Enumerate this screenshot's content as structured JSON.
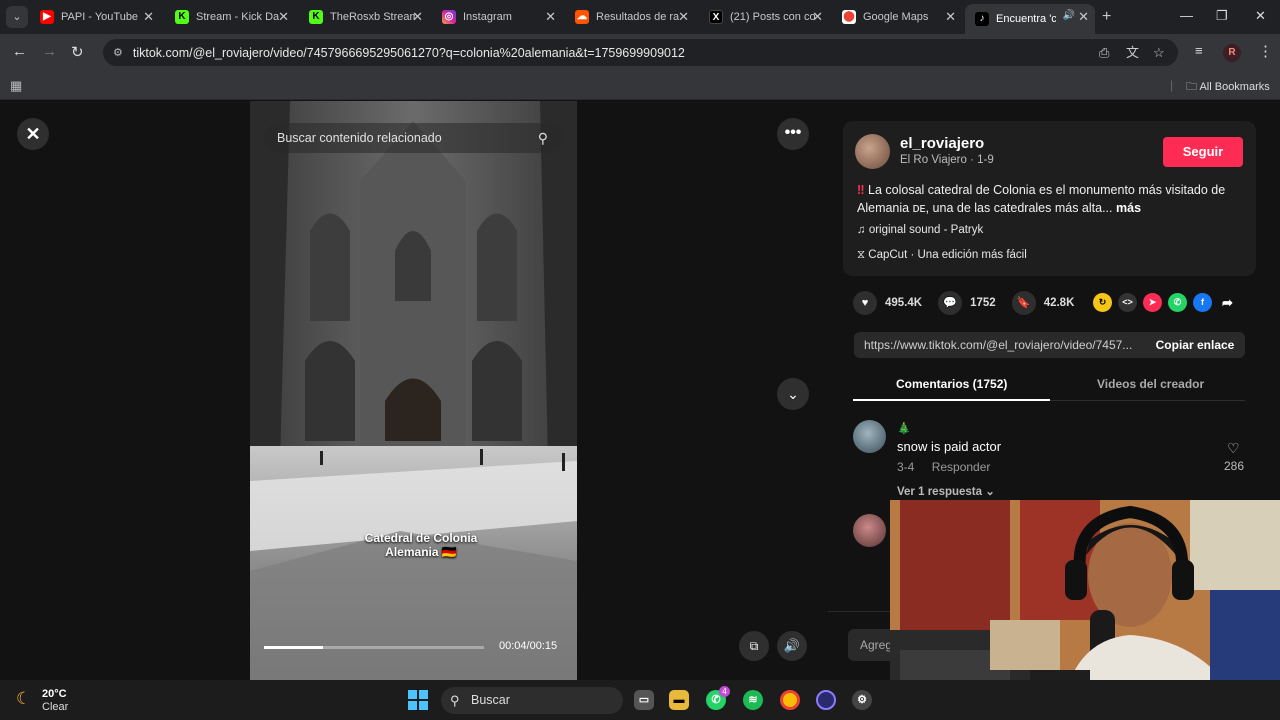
{
  "browser": {
    "tabs": [
      {
        "title": "PAPI - YouTube",
        "icon": "youtube-icon",
        "color": "#ff0000",
        "glyph": "▶"
      },
      {
        "title": "Stream - Kick Da",
        "icon": "kick-icon",
        "color": "#53fc18",
        "glyph": "K"
      },
      {
        "title": "TheRosxb Stream",
        "icon": "kick-icon",
        "color": "#53fc18",
        "glyph": "K"
      },
      {
        "title": "Instagram",
        "icon": "instagram-icon",
        "color": "#d6249f",
        "glyph": "◎"
      },
      {
        "title": "Resultados de ra",
        "icon": "soundcloud-icon",
        "color": "#ff5500",
        "glyph": "☁"
      },
      {
        "title": "(21) Posts con co",
        "icon": "x-icon",
        "color": "#000000",
        "glyph": "X"
      },
      {
        "title": "Google Maps",
        "icon": "google-maps-icon",
        "color": "#34a853",
        "glyph": "⬤"
      },
      {
        "title": "Encuentra 'co",
        "icon": "tiktok-icon",
        "color": "#000000",
        "glyph": "♪"
      }
    ],
    "url": "tiktok.com/@el_roviajero/video/7457966695295061270?q=colonia%20alemania&t=1759699909012",
    "profile_initial": "R",
    "all_bookmarks": "All Bookmarks"
  },
  "video": {
    "search_placeholder": "Buscar contenido relacionado",
    "location_caption_line1": "Catedral de Colonia",
    "location_caption_line2": "Alemania 🇩🇪",
    "timecode": "00:04/00:15",
    "progress_fraction": 0.27
  },
  "post": {
    "username": "el_roviajero",
    "display_name": "El Ro Viajero",
    "date": "1-9",
    "follow_label": "Seguir",
    "description_mark": "‼",
    "description": "La colosal catedral de Colonia es el monumento más visitado de Alemania ᴅᴇ, una de las catedrales más alta...",
    "more_label": "más",
    "sound": "original sound - Patryk",
    "capcut": "CapCut · Una edición más fácil",
    "likes": "495.4K",
    "comments": "1752",
    "saves": "42.8K",
    "link": "https://www.tiktok.com/@el_roviajero/video/7457...",
    "copy_label": "Copiar enlace",
    "tab_comments": "Comentarios (1752)",
    "tab_creator": "Videos del creador",
    "add_comment_placeholder": "Agreg"
  },
  "comment": {
    "user": "🎄",
    "text": "snow is paid actor",
    "date": "3-4",
    "reply_label": "Responder",
    "likes": "286",
    "view_replies": "Ver 1 respuesta"
  },
  "taskbar": {
    "temperature": "20°C",
    "condition": "Clear",
    "search_label": "Buscar",
    "whatsapp_badge": "4"
  },
  "colors": {
    "accent": "#fe2c55",
    "panel_bg": "#121212",
    "card_bg": "#1e1e1e"
  }
}
